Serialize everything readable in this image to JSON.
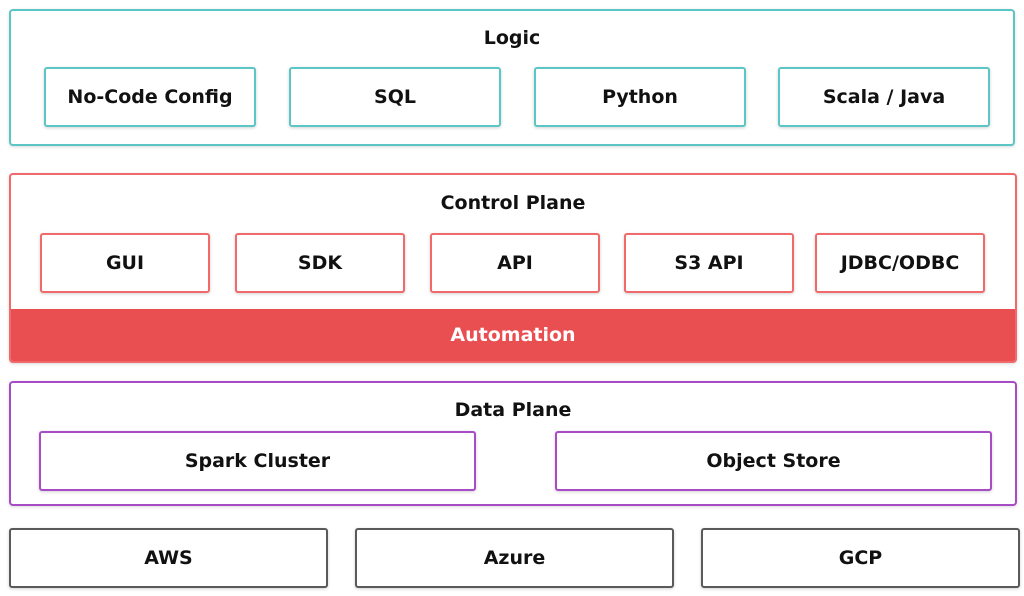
{
  "colors": {
    "logic": "#5cc6c6",
    "control": "#f06a6c",
    "automation": "#e94f51",
    "data": "#a74cc4",
    "cloud": "#5a5a5a"
  },
  "logic": {
    "title": "Logic",
    "items": [
      "No-Code Config",
      "SQL",
      "Python",
      "Scala / Java"
    ]
  },
  "control": {
    "title": "Control Plane",
    "items": [
      "GUI",
      "SDK",
      "API",
      "S3 API",
      "JDBC/ODBC"
    ],
    "automation": "Automation"
  },
  "data_plane": {
    "title": "Data Plane",
    "items": [
      "Spark Cluster",
      "Object Store"
    ]
  },
  "clouds": [
    "AWS",
    "Azure",
    "GCP"
  ]
}
